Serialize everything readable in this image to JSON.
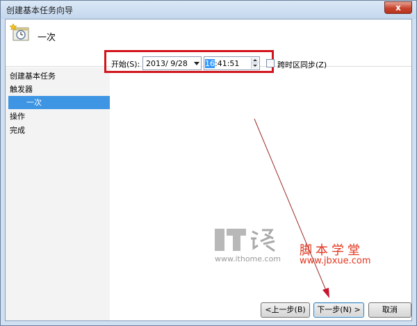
{
  "window": {
    "title": "创建基本任务向导",
    "close_label": "x"
  },
  "header": {
    "title": "一次",
    "icon": "scheduled-task-clock-icon"
  },
  "sidebar": {
    "items": [
      {
        "label": "创建基本任务"
      },
      {
        "label": "触发器"
      },
      {
        "label": "一次"
      },
      {
        "label": "操作"
      },
      {
        "label": "完成"
      }
    ]
  },
  "trigger": {
    "start_label": "开始(S):",
    "date_value": "2013/ 9/28",
    "time_hour": "16",
    "time_rest": ":41:51",
    "sync_label": "跨时区同步(Z)",
    "sync_checked": false
  },
  "watermarks": {
    "ithome_url": "www.ithome.com",
    "jbxue_name": "脚本学堂",
    "jbxue_url": "www.jbxue.com"
  },
  "buttons": {
    "back": "<上一步(B)",
    "next": "下一步(N) >",
    "cancel": "取消"
  },
  "colors": {
    "selection": "#3d95e3",
    "highlight_border": "#d1141b",
    "watermark_red": "#e2341d"
  }
}
